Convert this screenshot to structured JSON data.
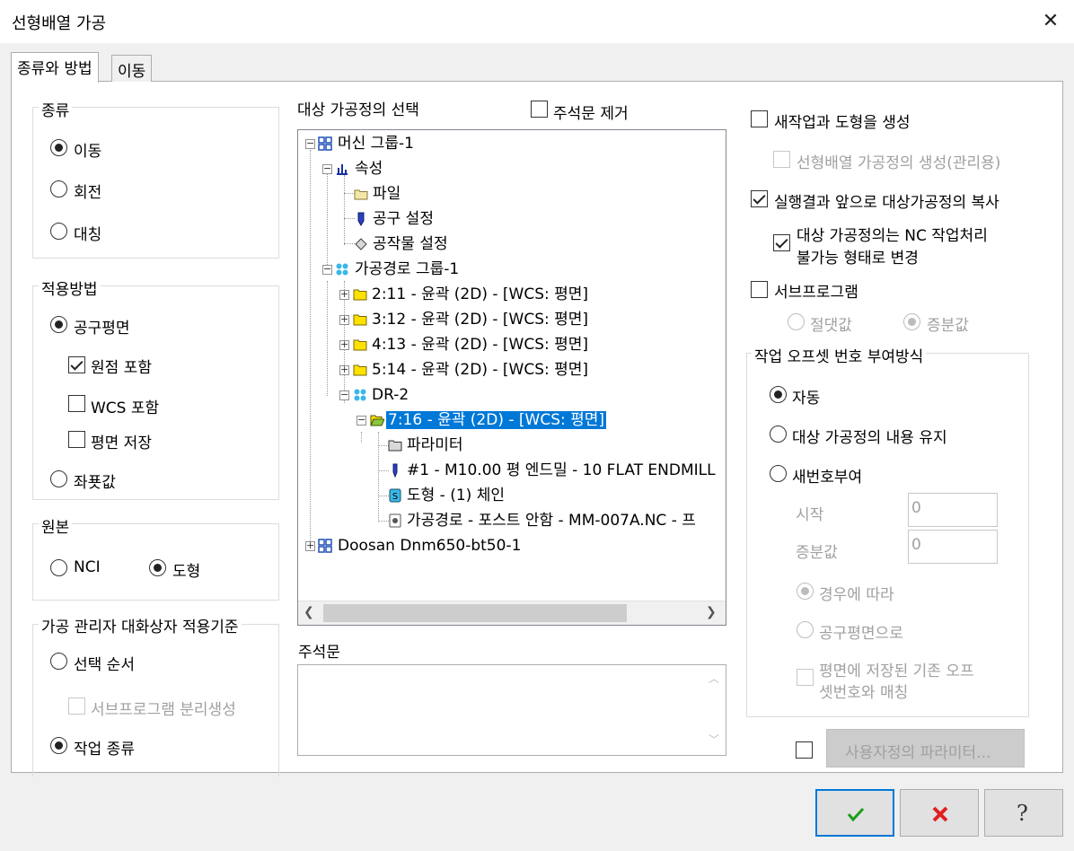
{
  "window": {
    "title": "선형배열 가공"
  },
  "tabs": [
    {
      "label": "종류와 방법"
    },
    {
      "label": "이동"
    }
  ],
  "type_group": {
    "title": "종류",
    "options": [
      {
        "label": "이동",
        "selected": true
      },
      {
        "label": "회전",
        "selected": false
      },
      {
        "label": "대칭",
        "selected": false
      }
    ]
  },
  "apply_group": {
    "title": "적용방법",
    "plane_label": "공구평면",
    "origin_label": "원점 포함",
    "wcs_label": "WCS 포함",
    "save_plane_label": "평면 저장",
    "coord_label": "좌푯값"
  },
  "source_group": {
    "title": "원본",
    "nci_label": "NCI",
    "geometry_label": "도형"
  },
  "manager_group": {
    "title": "가공 관리자 대화상자 적용기준",
    "selection_order_label": "선택 순서",
    "subprogram_split_label": "서브프로그램 분리생성",
    "operation_type_label": "작업 종류"
  },
  "target": {
    "title": "대상 가공정의 선택",
    "remove_comment_label": "주석문 제거"
  },
  "tree": {
    "machine_group": "머신 그룹-1",
    "properties": "속성",
    "files": "파일",
    "tool_settings": "공구 설정",
    "stock_settings": "공작물 설정",
    "toolpath_group": "가공경로 그룹-1",
    "op1": "2:11 - 윤곽 (2D) - [WCS: 평면]",
    "op2": "3:12 - 윤곽 (2D) - [WCS: 평면]",
    "op3": "4:13 - 윤곽 (2D) - [WCS: 평면]",
    "op4": "5:14 - 윤곽 (2D) - [WCS: 평면]",
    "dr_group": "DR-2",
    "op_selected": "7:16 - 윤곽 (2D) - [WCS: 평면]",
    "parameters": "파라미터",
    "tool": "#1 - M10.00 평 엔드밀 - 10 FLAT ENDMILL",
    "geometry": "도형 - (1) 체인",
    "toolpath": "가공경로 - 포스트 안함 - MM-007A.NC - 프",
    "machine2": "Doosan Dnm650-bt50-1"
  },
  "comment": {
    "label": "주석문"
  },
  "right": {
    "new_op_geometry_label": "새작업과 도형을 생성",
    "create_array_op_label": "선형배열 가공정의 생성(관리용)",
    "copy_before_after_label": "실행결과 앞으로 대상가공정의 복사",
    "change_to_disabled_label_1": "대상 가공정의는 NC 작업처리",
    "change_to_disabled_label_2": "불가능 형태로 변경",
    "subprogram_label": "서브프로그램",
    "absolute_label": "절댓값",
    "incremental_label": "증분값"
  },
  "offset_group": {
    "title": "작업 오프셋 번호 부여방식",
    "auto_label": "자동",
    "keep_label": "대상 가공정의 내용 유지",
    "renumber_label": "새번호부여",
    "start_label": "시작",
    "start_value": "0",
    "increment_label": "증분값",
    "increment_value": "0",
    "per_case_label": "경우에 따라",
    "by_tool_plane_label": "공구평면으로",
    "match_label_1": "평면에 저장된 기존 오프",
    "match_label_2": "셋번호와 매칭"
  },
  "custom_params_label": "사용자정의 파라미터...",
  "colors": {
    "selection": "#0078d7",
    "ok": "#1a9e1a",
    "cancel": "#e02020",
    "default_border": "#0078d7"
  }
}
